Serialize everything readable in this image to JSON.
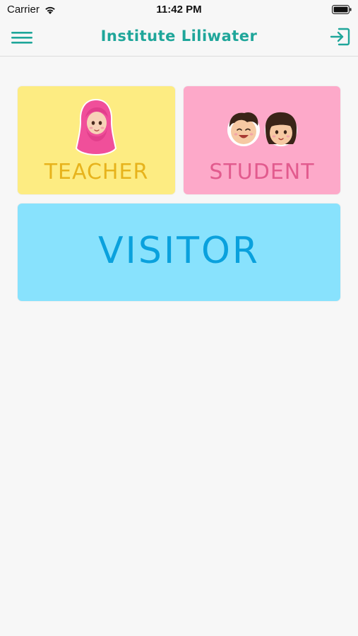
{
  "status_bar": {
    "carrier": "Carrier",
    "time": "11:42 PM",
    "icons": [
      "wifi-icon",
      "battery-icon"
    ]
  },
  "nav_bar": {
    "title": "Institute Liliwater",
    "left_icon": "hamburger-menu-icon",
    "right_icon": "login-icon",
    "accent_color": "#1fa69a"
  },
  "roles": {
    "teacher": {
      "label": "TEACHER",
      "background": "#fdec82",
      "text_color": "#e7b31c",
      "image": "teacher-girl-hijab-illustration"
    },
    "student": {
      "label": "STUDENT",
      "background": "#fda9c9",
      "text_color": "#e25b8e",
      "image": "two-kids-faces-illustration"
    },
    "visitor": {
      "label": "VISITOR",
      "background": "#88e2fd",
      "text_color": "#0aa1dd"
    }
  }
}
